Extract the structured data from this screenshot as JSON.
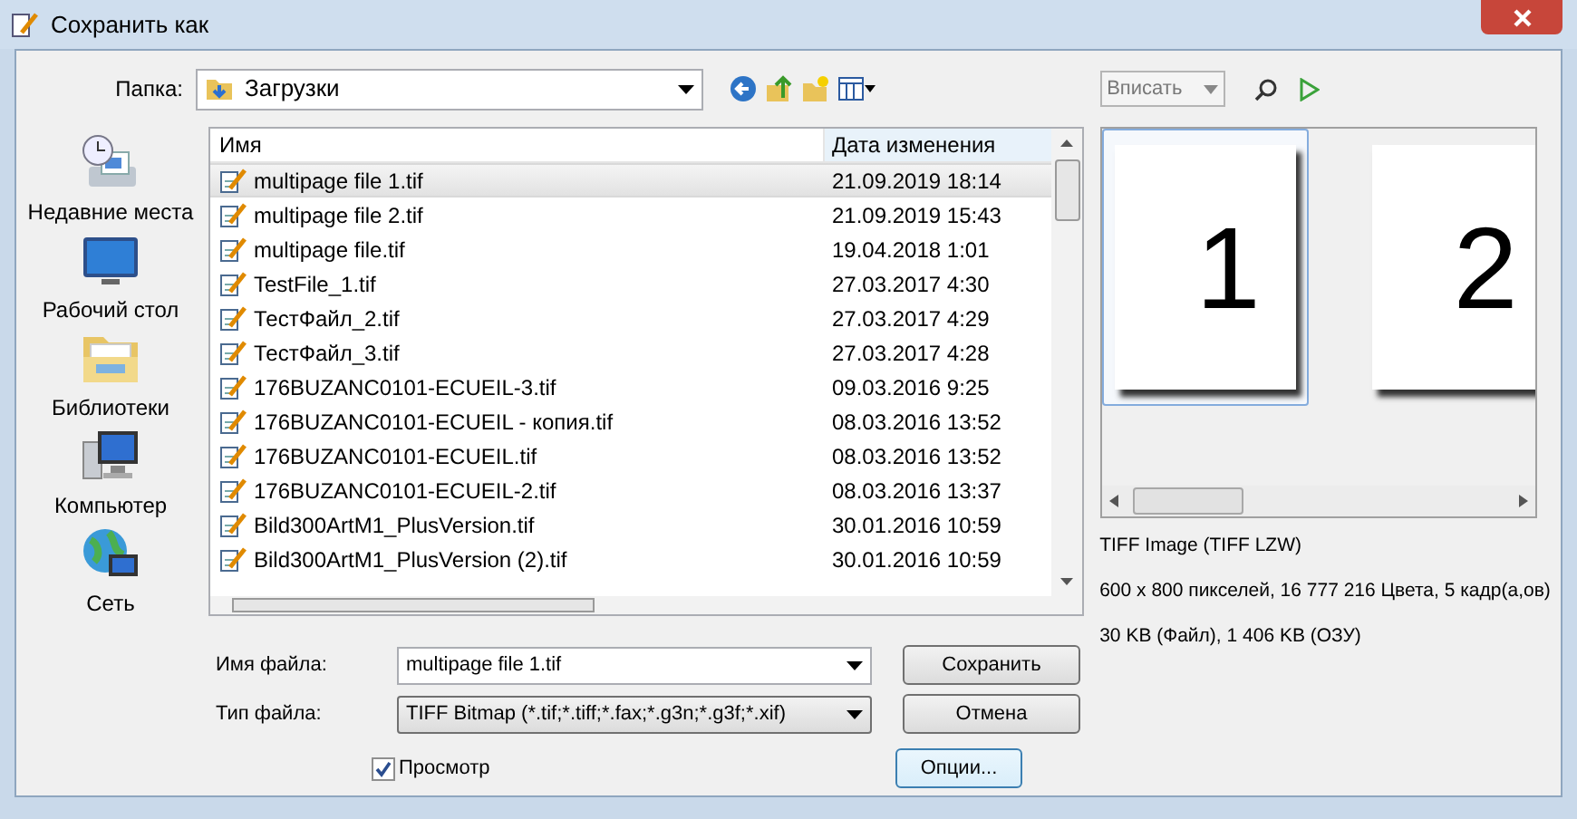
{
  "window": {
    "title": "Сохранить как"
  },
  "toolbar": {
    "folder_label": "Папка:",
    "folder": "Загрузки",
    "fit_select": "Вписать"
  },
  "places": [
    {
      "label": "Недавние места",
      "kind": "recent"
    },
    {
      "label": "Рабочий стол",
      "kind": "desktop"
    },
    {
      "label": "Библиотеки",
      "kind": "libraries"
    },
    {
      "label": "Компьютер",
      "kind": "computer"
    },
    {
      "label": "Сеть",
      "kind": "network"
    }
  ],
  "file_list": {
    "columns": [
      "Имя",
      "Дата изменения"
    ],
    "rows": [
      {
        "name": "multipage file 1.tif",
        "date": "21.09.2019 18:14",
        "selected": true
      },
      {
        "name": "multipage file 2.tif",
        "date": "21.09.2019 15:43",
        "selected": false
      },
      {
        "name": "multipage file.tif",
        "date": "19.04.2018 1:01",
        "selected": false
      },
      {
        "name": "TestFile_1.tif",
        "date": "27.03.2017 4:30",
        "selected": false
      },
      {
        "name": "ТестФайл_2.tif",
        "date": "27.03.2017 4:29",
        "selected": false
      },
      {
        "name": "ТестФайл_3.tif",
        "date": "27.03.2017 4:28",
        "selected": false
      },
      {
        "name": "176BUZANC0101-ECUEIL-3.tif",
        "date": "09.03.2016 9:25",
        "selected": false
      },
      {
        "name": "176BUZANC0101-ECUEIL - копия.tif",
        "date": "08.03.2016 13:52",
        "selected": false
      },
      {
        "name": "176BUZANC0101-ECUEIL.tif",
        "date": "08.03.2016 13:52",
        "selected": false
      },
      {
        "name": "176BUZANC0101-ECUEIL-2.tif",
        "date": "08.03.2016 13:37",
        "selected": false
      },
      {
        "name": "Bild300ArtM1_PlusVersion.tif",
        "date": "30.01.2016 10:59",
        "selected": false
      },
      {
        "name": "Bild300ArtM1_PlusVersion (2).tif",
        "date": "30.01.2016 10:59",
        "selected": false
      }
    ]
  },
  "preview": {
    "pages": [
      {
        "number": "1",
        "selected": true
      },
      {
        "number": "2",
        "selected": false
      }
    ],
    "info": [
      "TIFF Image (TIFF LZW)",
      "600 x 800 пикселей, 16 777 216 Цвета, 5 кадр(а,ов)",
      "30 KB (Файл), 1 406 KB (ОЗУ)"
    ]
  },
  "form": {
    "filename_label": "Имя файла:",
    "filename": "multipage file 1.tif",
    "type_label": "Тип файла:",
    "type": "TIFF Bitmap (*.tif;*.tiff;*.fax;*.g3n;*.g3f;*.xif)",
    "preview_checkbox": {
      "label": "Просмотр",
      "checked": true
    }
  },
  "buttons": [
    {
      "label": "Сохранить"
    },
    {
      "label": "Отмена"
    },
    {
      "label": "Опции..."
    }
  ]
}
